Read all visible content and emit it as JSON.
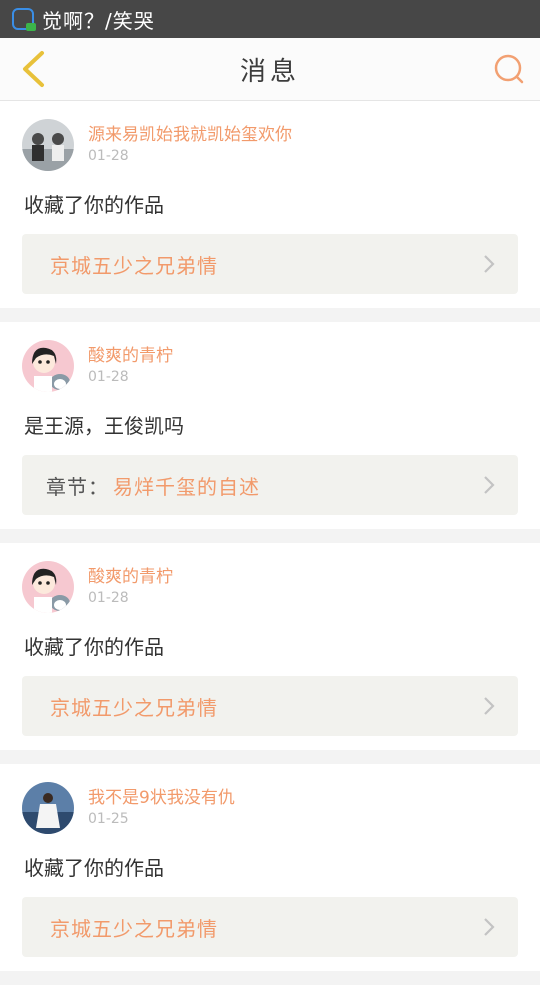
{
  "status_bar": {
    "text": "觉啊？/笑哭"
  },
  "nav": {
    "title": "消息"
  },
  "notifications": [
    {
      "user": "源来易凯始我就凯始玺欢你",
      "date": "01-28",
      "message": "收藏了你的作品",
      "ref_prefix": "",
      "ref_title": "京城五少之兄弟情"
    },
    {
      "user": "酸爽的青柠",
      "date": "01-28",
      "message": "是王源，王俊凯吗",
      "ref_prefix": "章节：",
      "ref_title": "易烊千玺的自述"
    },
    {
      "user": "酸爽的青柠",
      "date": "01-28",
      "message": "收藏了你的作品",
      "ref_prefix": "",
      "ref_title": "京城五少之兄弟情"
    },
    {
      "user": "我不是9状我没有仇",
      "date": "01-25",
      "message": "收藏了你的作品",
      "ref_prefix": "",
      "ref_title": "京城五少之兄弟情"
    }
  ],
  "colors": {
    "accent": "#f29a6b",
    "back_arrow": "#e8c13a"
  }
}
